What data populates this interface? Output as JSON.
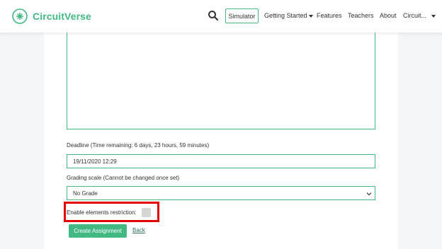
{
  "navbar": {
    "brand": "CircuitVerse",
    "simulator_label": "Simulator",
    "getting_started_label": "Getting Started",
    "features_label": "Features",
    "teachers_label": "Teachers",
    "about_label": "About",
    "user_label": "Circuit..."
  },
  "form": {
    "deadline_label": "Deadline (Time remaining: 6 days, 23 hours, 59 minutes)",
    "deadline_value": "19/11/2020 12:29",
    "grading_label": "Grading scale (Cannot be changed once set)",
    "grading_selected": "No Grade",
    "restriction_label": "Enable elements restriction:",
    "restriction_checked": false,
    "create_button": "Create Assignment",
    "back_link": "Back"
  },
  "colors": {
    "brand": "#42b983",
    "highlight": "#e30000"
  },
  "icons": [
    "circuitverse-logo",
    "search-icon",
    "caret-down-icon",
    "chevron-down-icon"
  ]
}
